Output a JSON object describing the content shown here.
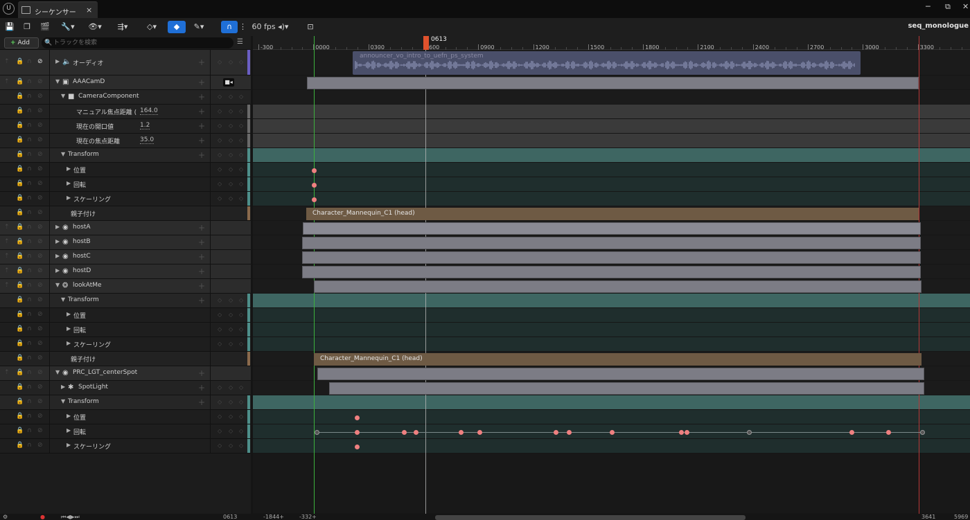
{
  "window": {
    "logo": "U",
    "tab_label": "シーケンサー",
    "tab_close": "×",
    "minimize": "─",
    "restore": "⧉",
    "close": "✕"
  },
  "toolbar": {
    "fps_label": "60 fps",
    "sequence_name": "seq_monologue"
  },
  "outliner": {
    "add_label": "Add",
    "search_placeholder": "トラックを検索",
    "tracks": [
      {
        "label": "オーディオ",
        "depth": 0,
        "kind": "top",
        "expander": "collapsed",
        "icon": "speaker-icon",
        "glyph": "🔈"
      },
      {
        "label": "AAACamD",
        "depth": 0,
        "kind": "top",
        "expander": "expanded",
        "icon": "camera-actor-icon",
        "glyph": "▣",
        "camera_button": true
      },
      {
        "label": "CameraComponent",
        "depth": 1,
        "kind": "sub",
        "expander": "expanded",
        "icon": "camera-component-icon",
        "glyph": "■"
      },
      {
        "label": "マニュアル焦点距離 (",
        "depth": 2,
        "kind": "prop",
        "value": "164.0"
      },
      {
        "label": "現在の開口値",
        "depth": 2,
        "kind": "prop",
        "value": "1.2"
      },
      {
        "label": "現在の焦点距離",
        "depth": 2,
        "kind": "prop",
        "value": "35.0"
      },
      {
        "label": "Transform",
        "depth": 1,
        "kind": "transform",
        "expander": "expanded"
      },
      {
        "label": "位置",
        "depth": 2,
        "kind": "channel",
        "expander": "collapsed"
      },
      {
        "label": "回転",
        "depth": 2,
        "kind": "channel",
        "expander": "collapsed"
      },
      {
        "label": "スケーリング",
        "depth": 2,
        "kind": "channel",
        "expander": "collapsed"
      },
      {
        "label": "親子付け",
        "depth": 1,
        "kind": "attach"
      },
      {
        "label": "hostA",
        "depth": 0,
        "kind": "top",
        "expander": "collapsed",
        "icon": "skeletal-mesh-icon",
        "glyph": "◉"
      },
      {
        "label": "hostB",
        "depth": 0,
        "kind": "top",
        "expander": "collapsed",
        "icon": "skeletal-mesh-icon",
        "glyph": "◉"
      },
      {
        "label": "hostC",
        "depth": 0,
        "kind": "top",
        "expander": "collapsed",
        "icon": "skeletal-mesh-icon",
        "glyph": "◉"
      },
      {
        "label": "hostD",
        "depth": 0,
        "kind": "top",
        "expander": "collapsed",
        "icon": "skeletal-mesh-icon",
        "glyph": "◉"
      },
      {
        "label": "lookAtMe",
        "depth": 0,
        "kind": "top",
        "expander": "expanded",
        "icon": "actor-icon",
        "glyph": "❂"
      },
      {
        "label": "Transform",
        "depth": 1,
        "kind": "transform",
        "expander": "expanded"
      },
      {
        "label": "位置",
        "depth": 2,
        "kind": "channel",
        "expander": "collapsed"
      },
      {
        "label": "回転",
        "depth": 2,
        "kind": "channel",
        "expander": "collapsed"
      },
      {
        "label": "スケーリング",
        "depth": 2,
        "kind": "channel",
        "expander": "collapsed"
      },
      {
        "label": "親子付け",
        "depth": 1,
        "kind": "attach"
      },
      {
        "label": "PRC_LGT_centerSpot",
        "depth": 0,
        "kind": "top",
        "expander": "expanded",
        "icon": "light-actor-icon",
        "glyph": "◉"
      },
      {
        "label": "SpotLight",
        "depth": 1,
        "kind": "sub",
        "expander": "collapsed",
        "icon": "spotlight-icon",
        "glyph": "✱"
      },
      {
        "label": "Transform",
        "depth": 1,
        "kind": "transform",
        "expander": "expanded"
      },
      {
        "label": "位置",
        "depth": 2,
        "kind": "channel",
        "expander": "collapsed"
      },
      {
        "label": "回転",
        "depth": 2,
        "kind": "channel",
        "expander": "collapsed"
      },
      {
        "label": "スケーリング",
        "depth": 2,
        "kind": "channel",
        "expander": "collapsed"
      }
    ]
  },
  "timeline": {
    "ruler_ticks": [
      "-300",
      "0000",
      "0300",
      "0600",
      "0900",
      "1200",
      "1500",
      "1800",
      "2100",
      "2400",
      "2700",
      "3000",
      "3300"
    ],
    "playhead_frame": "0613",
    "audio_clip_name": "announcer_vo_intro_to_uefn_ps_system",
    "attach_clip_1": "Character_Mannequin_C1 (head)",
    "attach_clip_2": "Character_Mannequin_C1 (head)"
  },
  "statusbar": {
    "current_frame": "0613",
    "left_view_start": "-1844+",
    "left_view_end": "-332+",
    "right_view_end": "3641",
    "right_view_total": "5969"
  },
  "colors": {
    "accent_blue": "#1f6fd6",
    "playhead": "#e0522d",
    "start_marker": "#3db23d",
    "end_marker": "#b83838",
    "key": "#ef8080",
    "transform_row": "#3e6662"
  }
}
